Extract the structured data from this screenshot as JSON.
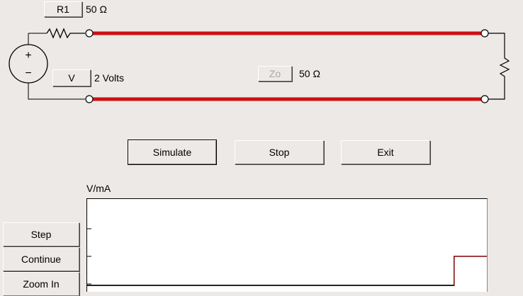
{
  "circuit": {
    "r1_button": "R1",
    "r1_value": "50 Ω",
    "v_button": "V",
    "v_value": "2 Volts",
    "zo_button": "Zo",
    "zo_value": "50 Ω",
    "line_color": "#cc1111"
  },
  "controls": {
    "simulate": "Simulate",
    "stop": "Stop",
    "exit": "Exit"
  },
  "side": {
    "step": "Step",
    "continue": "Continue",
    "zoom_in": "Zoom In"
  },
  "chart_data": {
    "type": "line",
    "ylabel": "V/mA",
    "series": [
      {
        "color": "#800000",
        "points": [
          [
            0,
            0
          ],
          [
            0.918,
            0
          ],
          [
            0.918,
            1
          ],
          [
            1,
            1
          ]
        ]
      },
      {
        "color": "#000000",
        "points": [
          [
            0,
            0
          ],
          [
            0.918,
            0
          ]
        ]
      }
    ]
  }
}
